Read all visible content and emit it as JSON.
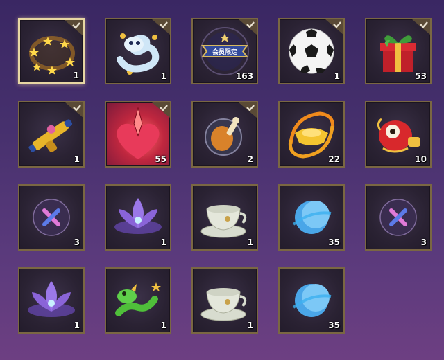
{
  "inventory": {
    "items": [
      {
        "name": "gold-star-ring",
        "count": "1",
        "claimed": true,
        "selected": true
      },
      {
        "name": "white-dragon-spirit",
        "count": "1",
        "claimed": true
      },
      {
        "name": "member-exclusive-badge",
        "count": "163",
        "claimed": true,
        "badge_text": "会员限定"
      },
      {
        "name": "soccer-ball",
        "count": "1",
        "claimed": true
      },
      {
        "name": "gift-box",
        "count": "53",
        "claimed": false
      },
      {
        "name": "toy-blaster",
        "count": "1",
        "claimed": true
      },
      {
        "name": "heart-blade",
        "count": "55",
        "claimed": true
      },
      {
        "name": "roast-drumstick",
        "count": "2",
        "claimed": true
      },
      {
        "name": "gold-ingot-swirl",
        "count": "22",
        "claimed": false
      },
      {
        "name": "lion-dance-ornament",
        "count": "10",
        "claimed": false
      },
      {
        "name": "purple-x-orb",
        "count": "3",
        "claimed": false
      },
      {
        "name": "purple-lotus",
        "count": "1",
        "claimed": false
      },
      {
        "name": "tea-cup",
        "count": "1",
        "claimed": false
      },
      {
        "name": "blue-moon-orb",
        "count": "35",
        "claimed": false
      },
      {
        "name": "purple-x-orb",
        "count": "3",
        "claimed": false
      },
      {
        "name": "purple-lotus",
        "count": "1",
        "claimed": false
      },
      {
        "name": "green-dragon",
        "count": "1",
        "claimed": false
      },
      {
        "name": "tea-cup",
        "count": "1",
        "claimed": false
      },
      {
        "name": "blue-moon-orb",
        "count": "35",
        "claimed": false
      }
    ]
  }
}
